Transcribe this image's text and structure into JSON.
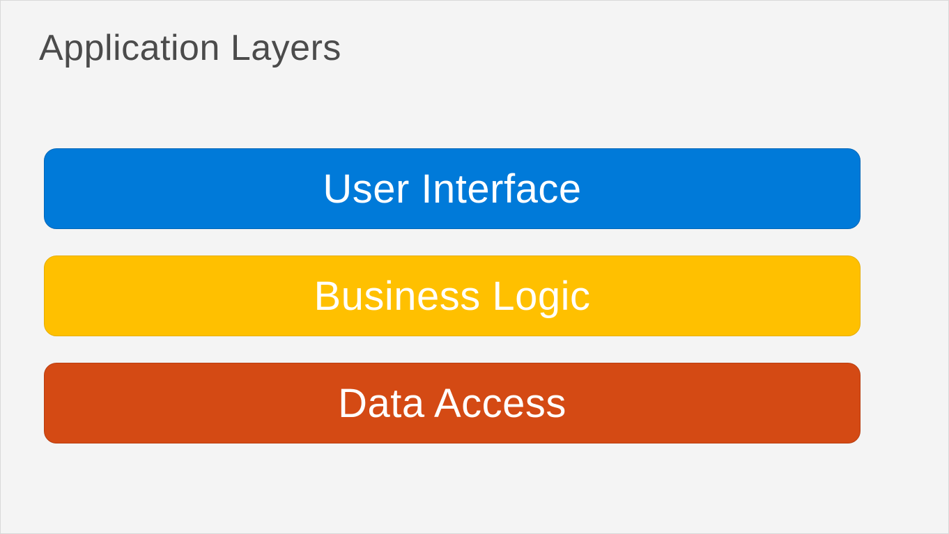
{
  "title": "Application Layers",
  "layers": [
    {
      "label": "User Interface",
      "color": "#007ad9"
    },
    {
      "label": "Business Logic",
      "color": "#ffc000"
    },
    {
      "label": "Data Access",
      "color": "#d44a14"
    }
  ]
}
